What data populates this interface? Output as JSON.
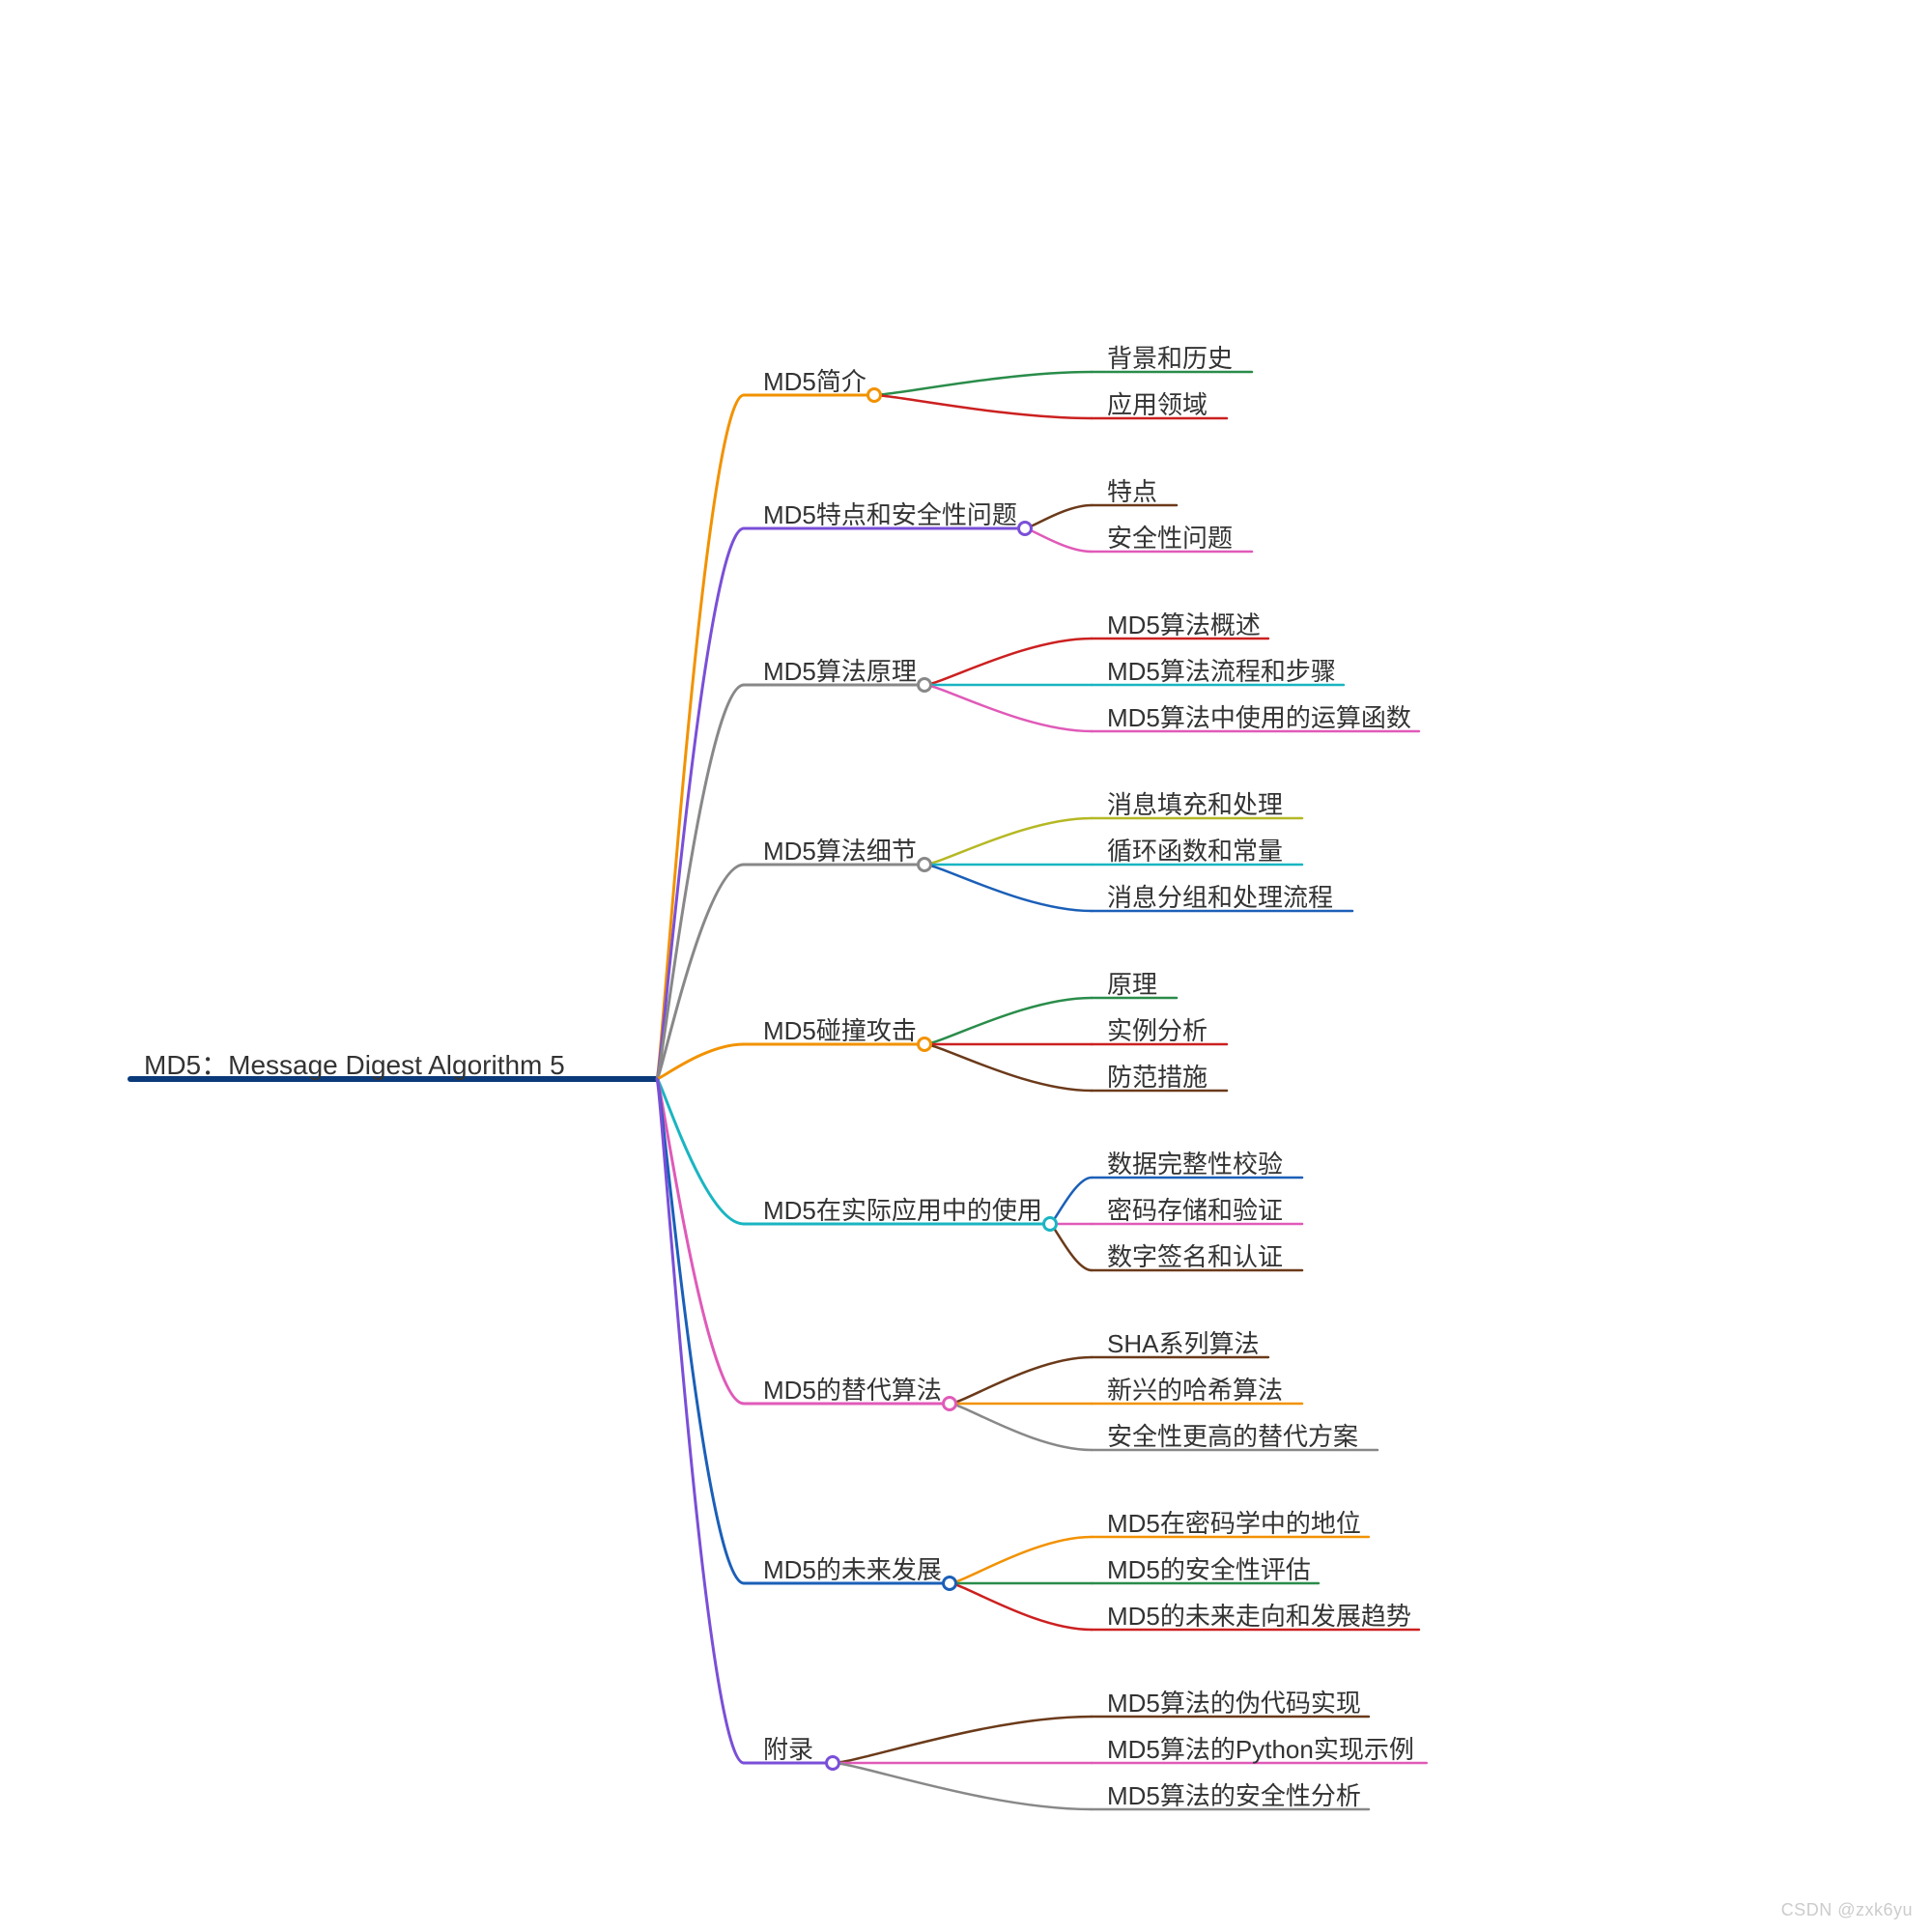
{
  "root": {
    "label": "MD5：Message Digest Algorithm 5",
    "color": "#0a3a7a"
  },
  "branches": [
    {
      "label": "MD5简介",
      "color": "#f29200",
      "children": [
        {
          "label": "背景和历史",
          "color": "#2a8c4a"
        },
        {
          "label": "应用领域",
          "color": "#cc2020"
        }
      ]
    },
    {
      "label": "MD5特点和安全性问题",
      "color": "#7a4fd8",
      "children": [
        {
          "label": "特点",
          "color": "#6b3a1a"
        },
        {
          "label": "安全性问题",
          "color": "#e05ab8"
        }
      ]
    },
    {
      "label": "MD5算法原理",
      "color": "#888888",
      "children": [
        {
          "label": "MD5算法概述",
          "color": "#cc2020"
        },
        {
          "label": "MD5算法流程和步骤",
          "color": "#19b5c2"
        },
        {
          "label": "MD5算法中使用的运算函数",
          "color": "#e05ab8"
        }
      ]
    },
    {
      "label": "MD5算法细节",
      "color": "#888888",
      "children": [
        {
          "label": "消息填充和处理",
          "color": "#b5b824"
        },
        {
          "label": "循环函数和常量",
          "color": "#19b5c2"
        },
        {
          "label": "消息分组和处理流程",
          "color": "#1b5fb8"
        }
      ]
    },
    {
      "label": "MD5碰撞攻击",
      "color": "#f29200",
      "children": [
        {
          "label": "原理",
          "color": "#2a8c4a"
        },
        {
          "label": "实例分析",
          "color": "#cc2020"
        },
        {
          "label": "防范措施",
          "color": "#6b3a1a"
        }
      ]
    },
    {
      "label": "MD5在实际应用中的使用",
      "color": "#19b5c2",
      "children": [
        {
          "label": "数据完整性校验",
          "color": "#1b5fb8"
        },
        {
          "label": "密码存储和验证",
          "color": "#e05ab8"
        },
        {
          "label": "数字签名和认证",
          "color": "#6b3a1a"
        }
      ]
    },
    {
      "label": "MD5的替代算法",
      "color": "#e05ab8",
      "children": [
        {
          "label": "SHA系列算法",
          "color": "#6b3a1a"
        },
        {
          "label": "新兴的哈希算法",
          "color": "#f29200"
        },
        {
          "label": "安全性更高的替代方案",
          "color": "#888888"
        }
      ]
    },
    {
      "label": "MD5的未来发展",
      "color": "#1b5fb8",
      "children": [
        {
          "label": "MD5在密码学中的地位",
          "color": "#f29200"
        },
        {
          "label": "MD5的安全性评估",
          "color": "#2a8c4a"
        },
        {
          "label": "MD5的未来走向和发展趋势",
          "color": "#cc2020"
        }
      ]
    },
    {
      "label": "附录",
      "color": "#7a4fd8",
      "children": [
        {
          "label": "MD5算法的伪代码实现",
          "color": "#6b3a1a"
        },
        {
          "label": "MD5算法的Python实现示例",
          "color": "#e05ab8"
        },
        {
          "label": "MD5算法的安全性分析",
          "color": "#888888"
        }
      ]
    }
  ],
  "watermark": "CSDN @zxk6yu"
}
